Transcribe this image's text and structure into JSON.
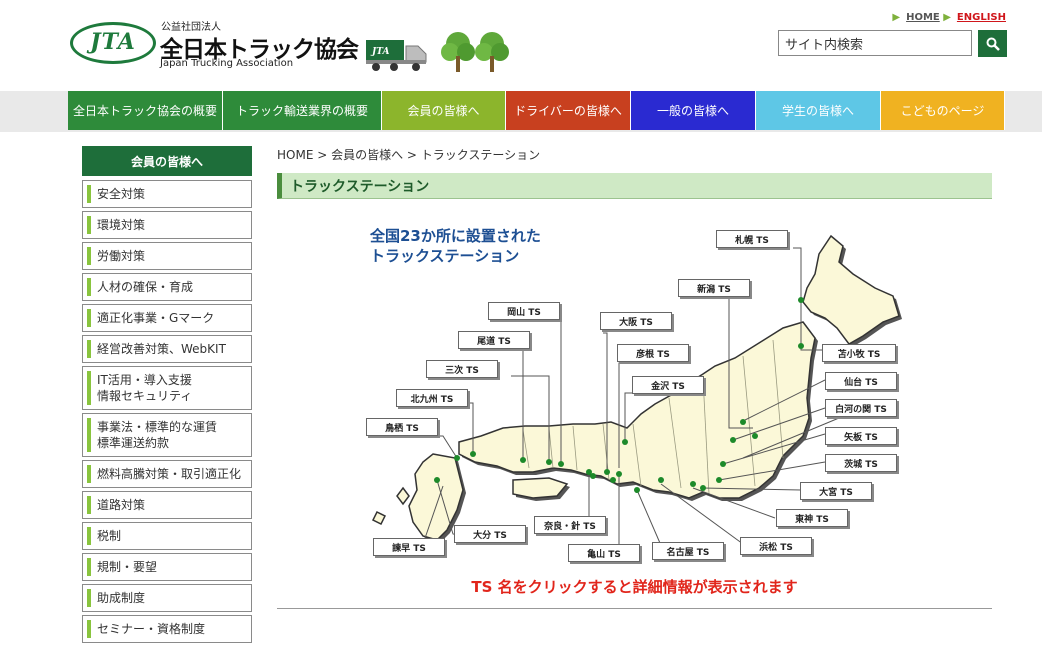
{
  "header": {
    "logo_mark": "JTA",
    "logo_small": "公益社団法人",
    "logo_main": "全日本トラック協会",
    "logo_en": "Japan Trucking Association",
    "links": {
      "home": "HOME",
      "english": "ENGLISH"
    },
    "search": {
      "value": "サイト内検索"
    }
  },
  "nav": [
    {
      "label": "全日本トラック協会の概要",
      "color": "#2e8b3a"
    },
    {
      "label": "トラック輸送業界の概要",
      "color": "#2e8b3a"
    },
    {
      "label": "会員の皆様へ",
      "color": "#8cb52c"
    },
    {
      "label": "ドライバーの皆様へ",
      "color": "#c8401f"
    },
    {
      "label": "一般の皆様へ",
      "color": "#2a2ad1"
    },
    {
      "label": "学生の皆様へ",
      "color": "#5ec7e6"
    },
    {
      "label": "こどものページ",
      "color": "#f0b221"
    }
  ],
  "sidebar": {
    "heading": "会員の皆様へ",
    "items": [
      {
        "label": "安全対策"
      },
      {
        "label": "環境対策"
      },
      {
        "label": "労働対策"
      },
      {
        "label": "人材の確保・育成"
      },
      {
        "label": "適正化事業・Gマーク"
      },
      {
        "label": "経営改善対策、WebKIT"
      },
      {
        "label": "IT活用・導入支援\n情報セキュリティ"
      },
      {
        "label": "事業法・標準的な運賃\n標準運送約款"
      },
      {
        "label": "燃料高騰対策・取引適正化"
      },
      {
        "label": "道路対策"
      },
      {
        "label": "税制"
      },
      {
        "label": "規制・要望"
      },
      {
        "label": "助成制度"
      },
      {
        "label": "セミナー・資格制度"
      }
    ]
  },
  "breadcrumb": "HOME > 会員の皆様へ > トラックステーション",
  "page_title": "トラックステーション",
  "map": {
    "caption_line1": "全国23か所に設置された",
    "caption_line2": "トラックステーション",
    "stations": [
      {
        "name": "札幌 TS"
      },
      {
        "name": "新潟 TS"
      },
      {
        "name": "岡山 TS"
      },
      {
        "name": "大阪 TS"
      },
      {
        "name": "尾道 TS"
      },
      {
        "name": "彦根 TS"
      },
      {
        "name": "三次 TS"
      },
      {
        "name": "苫小牧 TS"
      },
      {
        "name": "金沢 TS"
      },
      {
        "name": "仙台 TS"
      },
      {
        "name": "北九州 TS"
      },
      {
        "name": "白河の関 TS"
      },
      {
        "name": "鳥栖 TS"
      },
      {
        "name": "矢板 TS"
      },
      {
        "name": "茨城 TS"
      },
      {
        "name": "大宮 TS"
      },
      {
        "name": "東神 TS"
      },
      {
        "name": "大分 TS"
      },
      {
        "name": "奈良・針 TS"
      },
      {
        "name": "諫早 TS"
      },
      {
        "name": "亀山 TS"
      },
      {
        "name": "名古屋 TS"
      },
      {
        "name": "浜松 TS"
      }
    ]
  },
  "notice": "TS 名をクリックすると詳細情報が表示されます"
}
